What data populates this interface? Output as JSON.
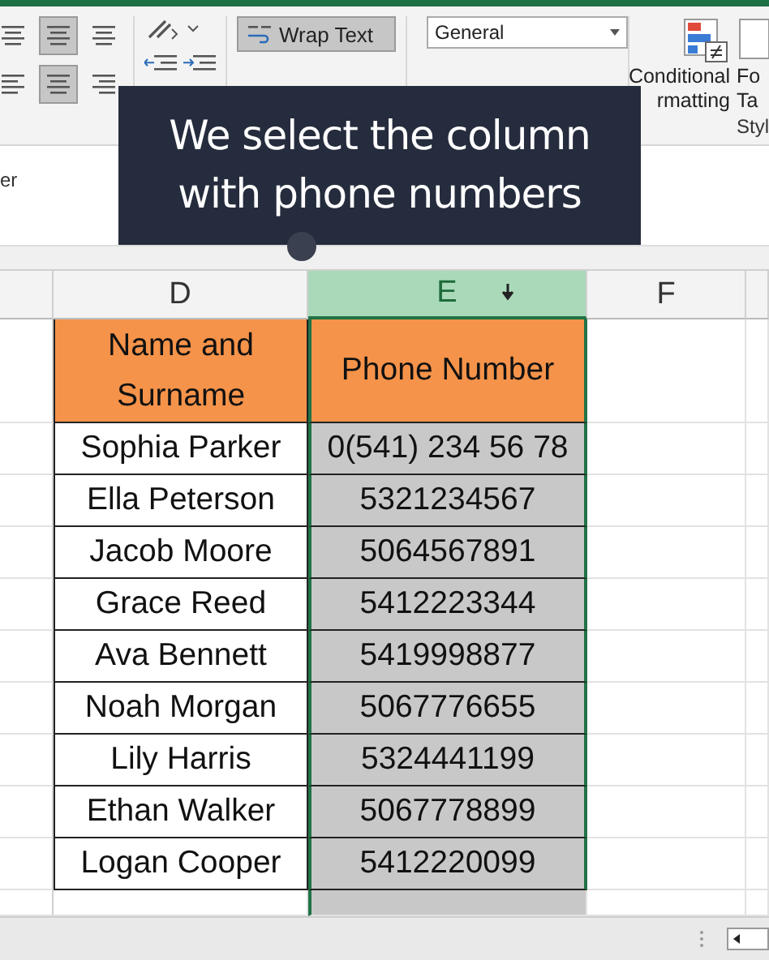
{
  "ribbon": {
    "align_top": [
      {
        "selected": false
      },
      {
        "selected": true
      },
      {
        "selected": false
      }
    ],
    "align_bottom": [
      {
        "selected": false
      },
      {
        "selected": true
      },
      {
        "selected": false
      }
    ],
    "wrap_text": {
      "label": "Wrap Text",
      "selected": true
    },
    "number_format": "General",
    "conditional_formatting": [
      "Conditional",
      "rmatting"
    ],
    "cut_labels": [
      "Fo",
      "Ta"
    ],
    "group_label": "Styl"
  },
  "name_box_text": "er",
  "callout": {
    "lines": [
      "We select the column",
      "with phone numbers"
    ]
  },
  "sheet": {
    "columns": [
      {
        "label": "D",
        "selected": false
      },
      {
        "label": "E",
        "selected": true
      },
      {
        "label": "F",
        "selected": false
      }
    ],
    "header": [
      "Name and Surname",
      "Phone Number"
    ],
    "rows": [
      [
        "Sophia Parker",
        "0(541) 234 56 78"
      ],
      [
        "Ella Peterson",
        "5321234567"
      ],
      [
        "Jacob Moore",
        "5064567891"
      ],
      [
        "Grace Reed",
        "5412223344"
      ],
      [
        "Ava Bennett",
        "5419998877"
      ],
      [
        "Noah Morgan",
        "5067776655"
      ],
      [
        "Lily Harris",
        "5324441199"
      ],
      [
        "Ethan Walker",
        "5067778899"
      ],
      [
        "Logan Cooper",
        "5412220099"
      ]
    ]
  }
}
